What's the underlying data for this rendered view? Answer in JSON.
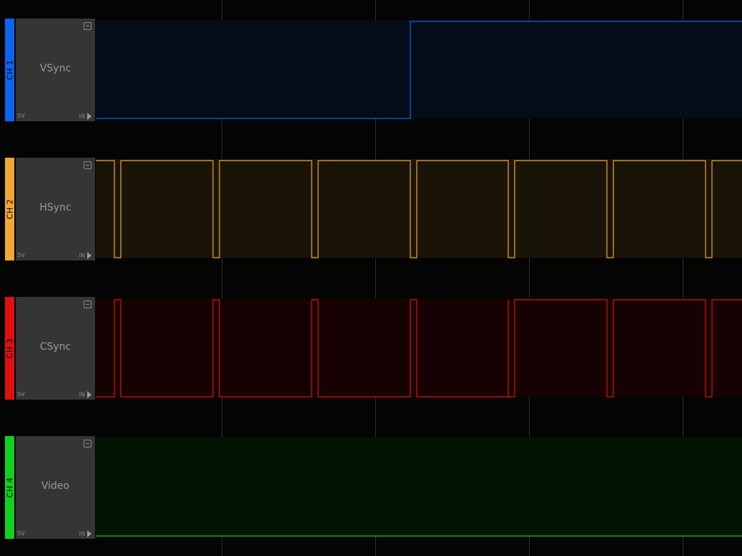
{
  "channels": [
    {
      "tag": "CH 1",
      "name": "VSync",
      "voltage": "5V",
      "input": "IN",
      "color": "#0a64f0",
      "fill": "#040c18",
      "level": "vsync"
    },
    {
      "tag": "CH 2",
      "name": "HSync",
      "voltage": "5V",
      "input": "IN",
      "color": "#f0a830",
      "fill": "#1a1408",
      "level": "hsync"
    },
    {
      "tag": "CH 3",
      "name": "CSync",
      "voltage": "5V",
      "input": "IN",
      "color": "#e01010",
      "fill": "#160202",
      "level": "csync"
    },
    {
      "tag": "CH 4",
      "name": "Video",
      "voltage": "5V",
      "input": "IN",
      "color": "#10d020",
      "fill": "#021502",
      "level": "video"
    }
  ]
}
